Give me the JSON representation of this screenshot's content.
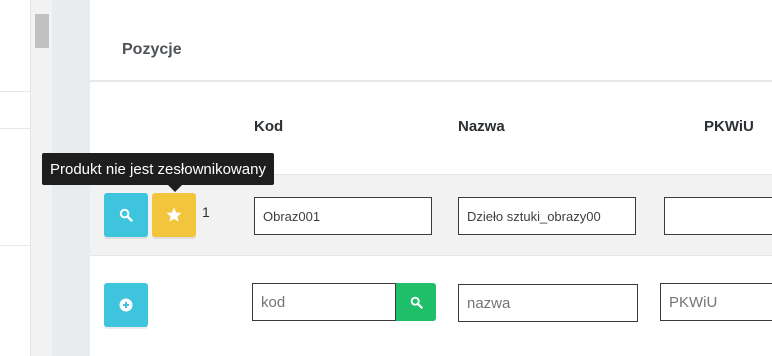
{
  "panel": {
    "title": "Pozycje"
  },
  "table": {
    "headers": [
      "Kod",
      "Nazwa",
      "PKWiU"
    ]
  },
  "row": {
    "index": "1",
    "kod": "Obraz001",
    "nazwa": "Dzieło sztuki_obrazy00",
    "pkwiu": ""
  },
  "new_row": {
    "kod_placeholder": "kod",
    "nazwa_placeholder": "nazwa",
    "pkwiu_placeholder": "PKWiU"
  },
  "tooltip": {
    "text": "Produkt nie jest zesłownikowany"
  },
  "icons": {
    "search": "search-icon",
    "star": "star-icon",
    "add": "plus-circle-icon"
  },
  "colors": {
    "cyan": "#3ec4dc",
    "yellow": "#f2c53d",
    "green": "#1fbf6a",
    "tooltip_bg": "#1e1e1e"
  }
}
